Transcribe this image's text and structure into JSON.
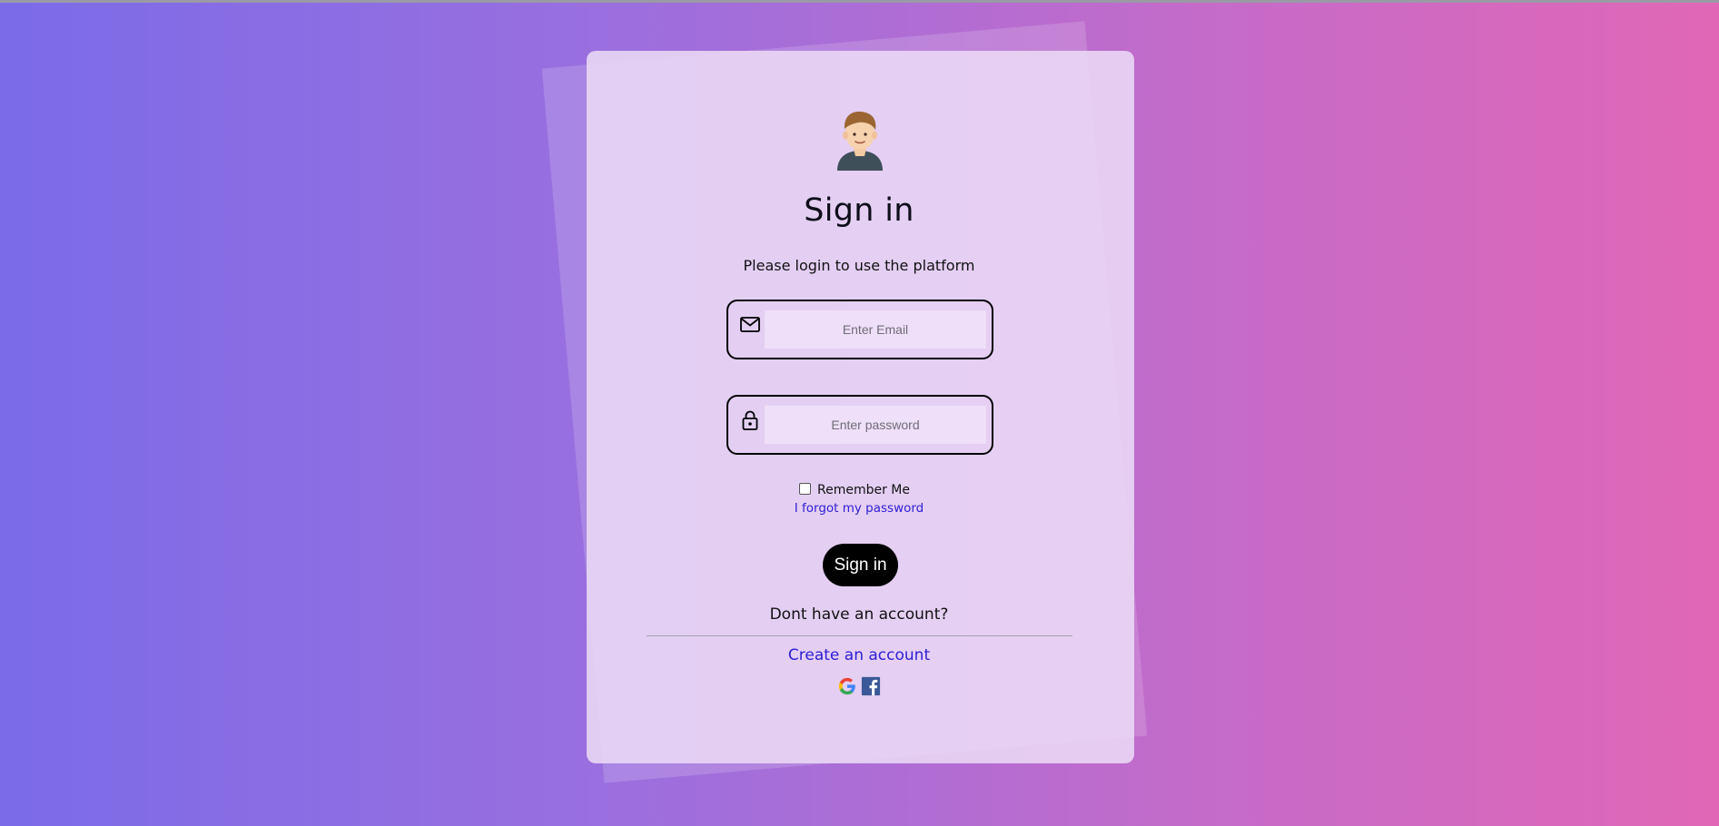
{
  "page": {
    "title": "Sign in",
    "subtitle": "Please login to use the platform"
  },
  "form": {
    "email": {
      "placeholder": "Enter Email",
      "value": "",
      "icon": "mail-icon"
    },
    "password": {
      "placeholder": "Enter password",
      "value": "",
      "icon": "lock-icon"
    },
    "remember_label": "Remember Me",
    "remember_checked": false,
    "forgot_label": "I forgot my password",
    "submit_label": "Sign in"
  },
  "footer": {
    "no_account_text": "Dont have an account?",
    "create_account_label": "Create an account",
    "social": [
      "google-icon",
      "facebook-icon"
    ]
  },
  "colors": {
    "gradient_start": "#7b6be8",
    "gradient_end": "#e167b6",
    "card_bg": "#ebdaf5",
    "link": "#2b1dd6",
    "button_bg": "#000000"
  }
}
